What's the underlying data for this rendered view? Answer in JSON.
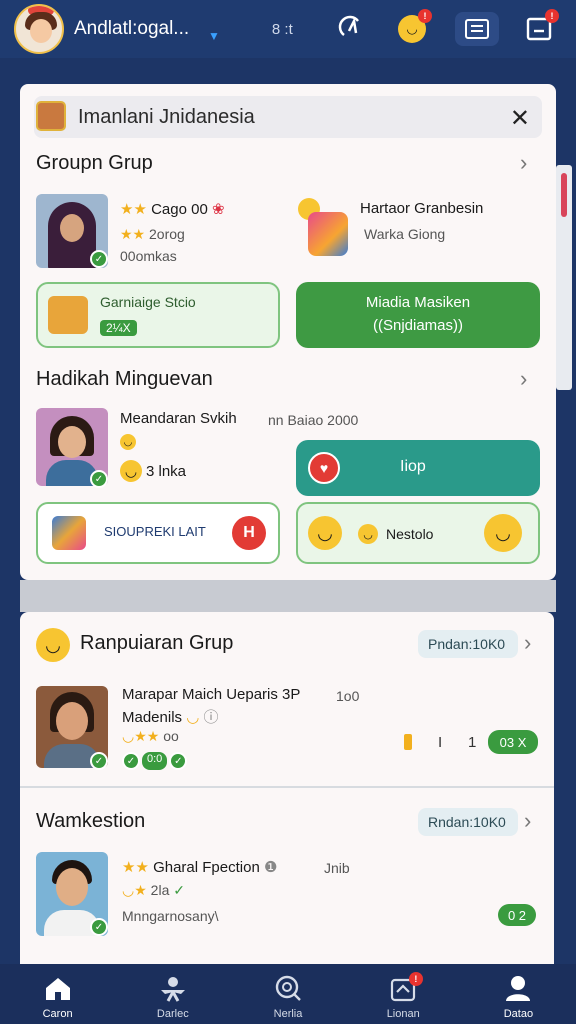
{
  "header": {
    "app_name": "Andlatl:ogal...",
    "counter": "8 :t",
    "emoji_badge": "!",
    "inbox_badge": "!"
  },
  "search": {
    "value": "Imanlani Jnidanesia",
    "close_icon": "close-icon"
  },
  "group_section": {
    "title": "Groupn Grup",
    "profile": {
      "line1": "Cago 00",
      "line2": "2orog",
      "line3": "00omkas"
    },
    "right_item": {
      "title": "Hartaor Granbesin",
      "subtitle": "Warka Giong"
    },
    "card_left": {
      "label": "Garniaige Stcio",
      "tag": "2¼X"
    },
    "card_right": {
      "line1": "Miadia Masiken",
      "line2": "((Snjdiamas))"
    }
  },
  "highlight_section": {
    "title": "Hadikah Minguevan",
    "profile": {
      "name": "Meandaran Svkih",
      "count": "3 lnka",
      "meta": "nn  Baiao 2000"
    },
    "hop_button": "Iiop",
    "card_left_label": "SIOUPREKI LAIT",
    "card_left_badge": "H",
    "card_right_label": "Nestolo"
  },
  "popular_section": {
    "title": "Ranpuiaran Grup",
    "pill": "Pndan:10K0",
    "post": {
      "line1": "Marapar Maich Ueparis 3P",
      "line2": "Madenils",
      "line3": "oo",
      "right_meta": "1o0",
      "count_left": "I",
      "count_right": "1",
      "badge": "03 X",
      "tags": "0:0"
    }
  },
  "mark_section": {
    "title": "Wamkestion",
    "pill": "Rndan:10K0",
    "post": {
      "line1": "Gharal Fpection",
      "line2": "2la",
      "line3": "Mnngarnosany\\",
      "right_meta": "Jnib",
      "badge": "0 2"
    }
  },
  "bottom_nav": [
    {
      "label": "Caron",
      "icon": "home-icon"
    },
    {
      "label": "Darlec",
      "icon": "people-icon"
    },
    {
      "label": "Nerlia",
      "icon": "search-icon"
    },
    {
      "label": "Lionan",
      "icon": "inbox-icon",
      "badge": "!"
    },
    {
      "label": "Datao",
      "icon": "profile-icon"
    }
  ],
  "colors": {
    "header_bg": "#1f3b70",
    "accent_green": "#3e9a43",
    "accent_teal": "#2a9a8a",
    "badge_red": "#e8332f"
  }
}
